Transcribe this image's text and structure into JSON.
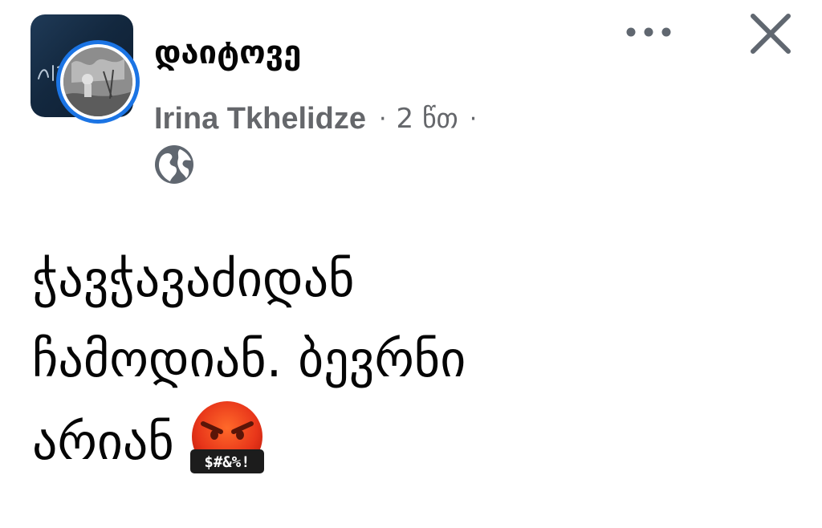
{
  "post": {
    "group_name": "დაიტოვე",
    "author": "Irina Tkhelidze",
    "separator": "·",
    "time": "2 წთ",
    "privacy_icon": "globe-icon",
    "text_lines": [
      "ჭავჭავაძიდან",
      "ჩამოდიან. ბევრნი",
      "არიან"
    ],
    "emoji": {
      "name": "face-with-symbols-on-mouth",
      "symbols": "$#&%!"
    }
  },
  "header_actions": {
    "more_icon": "more-horizontal-icon",
    "close_icon": "close-icon"
  },
  "colors": {
    "text_primary": "#050505",
    "text_secondary": "#65676b",
    "accent_blue": "#1b74e4",
    "icon_gray": "#606770"
  }
}
